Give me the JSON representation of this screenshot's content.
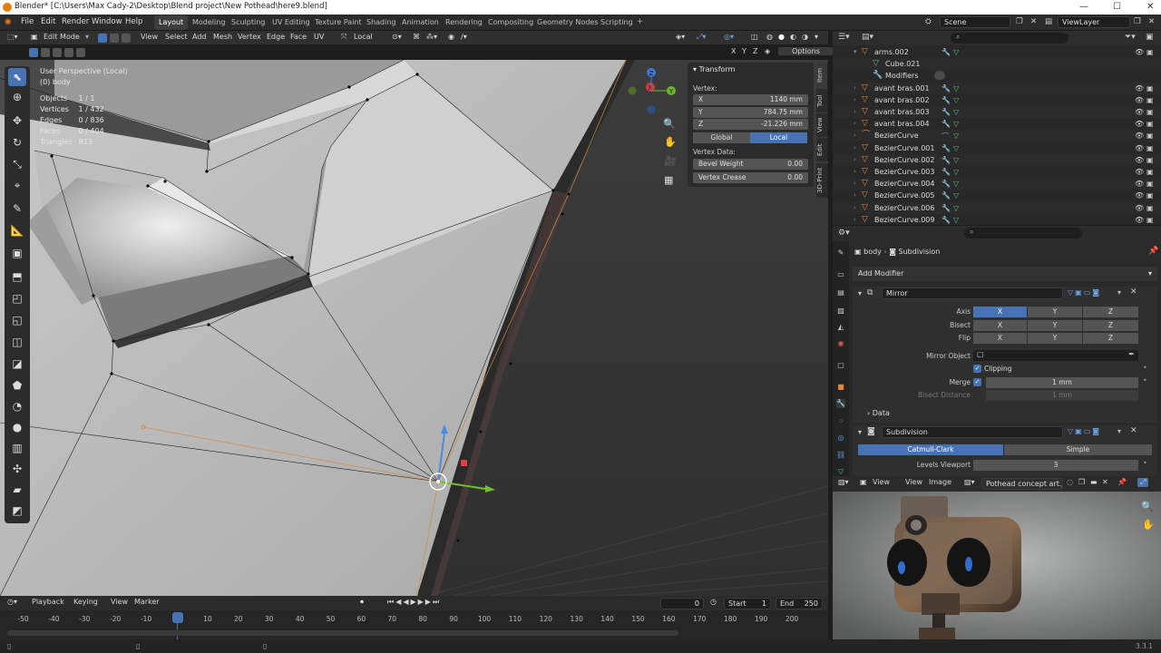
{
  "window": {
    "title": "Blender* [C:\\Users\\Max Cady-2\\Desktop\\Blend project\\New Pothead\\here9.blend]"
  },
  "menu": [
    "File",
    "Edit",
    "Render",
    "Window",
    "Help"
  ],
  "workspaces": [
    "Layout",
    "Modeling",
    "Sculpting",
    "UV Editing",
    "Texture Paint",
    "Shading",
    "Animation",
    "Rendering",
    "Compositing",
    "Geometry Nodes",
    "Scripting"
  ],
  "active_workspace": "Layout",
  "scene": "Scene",
  "view_layer": "ViewLayer",
  "viewport_header": {
    "mode": "Edit Mode",
    "menus": [
      "View",
      "Select",
      "Add",
      "Mesh",
      "Vertex",
      "Edge",
      "Face",
      "UV"
    ],
    "orientation": "Local",
    "axes": [
      "X",
      "Y",
      "Z"
    ],
    "options": "Options"
  },
  "overlay_info": {
    "view": "User Perspective (Local)",
    "object": "(0) body",
    "stats": [
      {
        "k": "Objects",
        "v": "1 / 1"
      },
      {
        "k": "Vertices",
        "v": "1 / 432"
      },
      {
        "k": "Edges",
        "v": "0 / 836"
      },
      {
        "k": "Faces",
        "v": "0 / 404"
      },
      {
        "k": "Triangles",
        "v": "813"
      }
    ]
  },
  "n_panel": {
    "section": "Transform",
    "vertex_label": "Vertex:",
    "x": "1140 mm",
    "y": "784.75 mm",
    "z": "-21.226 mm",
    "global": "Global",
    "local": "Local",
    "vertex_data_label": "Vertex Data:",
    "bevel_weight_label": "Bevel Weight",
    "bevel_weight": "0.00",
    "vertex_crease_label": "Vertex Crease",
    "vertex_crease": "0.00",
    "tabs": [
      "Item",
      "Tool",
      "View",
      "Edit",
      "3D-Print"
    ]
  },
  "outliner": [
    {
      "name": "arms.002",
      "indent": 1,
      "type": "mesh",
      "open": true
    },
    {
      "name": "Cube.021",
      "indent": 2,
      "type": "data"
    },
    {
      "name": "Modifiers",
      "indent": 2,
      "type": "modifiers"
    },
    {
      "name": "avant bras.001",
      "indent": 1,
      "type": "mesh"
    },
    {
      "name": "avant bras.002",
      "indent": 1,
      "type": "mesh"
    },
    {
      "name": "avant bras.003",
      "indent": 1,
      "type": "mesh"
    },
    {
      "name": "avant bras.004",
      "indent": 1,
      "type": "mesh"
    },
    {
      "name": "BezierCurve",
      "indent": 1,
      "type": "curve"
    },
    {
      "name": "BezierCurve.001",
      "indent": 1,
      "type": "mesh"
    },
    {
      "name": "BezierCurve.002",
      "indent": 1,
      "type": "mesh"
    },
    {
      "name": "BezierCurve.003",
      "indent": 1,
      "type": "mesh"
    },
    {
      "name": "BezierCurve.004",
      "indent": 1,
      "type": "mesh"
    },
    {
      "name": "BezierCurve.005",
      "indent": 1,
      "type": "mesh"
    },
    {
      "name": "BezierCurve.006",
      "indent": 1,
      "type": "mesh"
    },
    {
      "name": "BezierCurve.009",
      "indent": 1,
      "type": "mesh"
    }
  ],
  "properties": {
    "breadcrumb_object": "body",
    "breadcrumb_modifier": "Subdivision",
    "add_modifier": "Add Modifier",
    "mirror": {
      "name": "Mirror",
      "axis_label": "Axis",
      "bisect_label": "Bisect",
      "flip_label": "Flip",
      "xyz": [
        "X",
        "Y",
        "Z"
      ],
      "mirror_object_label": "Mirror Object",
      "clipping": "Clipping",
      "merge_label": "Merge",
      "merge_value": "1 mm",
      "bisect_distance_label": "Bisect Distance",
      "bisect_distance": "1 mm",
      "data_label": "Data"
    },
    "subdivision": {
      "name": "Subdivision",
      "catmull": "Catmull-Clark",
      "simple": "Simple",
      "levels_viewport_label": "Levels Viewport",
      "levels_viewport": "3"
    }
  },
  "image_editor": {
    "menus": [
      "View",
      "View",
      "Image"
    ],
    "image_name": "Pothead concept art.jpg"
  },
  "timeline": {
    "menus": [
      "Playback",
      "Keying",
      "View",
      "Marker"
    ],
    "current_frame": "0",
    "start_label": "Start",
    "start": "1",
    "end_label": "End",
    "end": "250",
    "ticks": [
      "-50",
      "-40",
      "-30",
      "-20",
      "-10",
      "0",
      "10",
      "20",
      "30",
      "40",
      "50",
      "60",
      "70",
      "80",
      "90",
      "100",
      "110",
      "120",
      "130",
      "140",
      "150",
      "160",
      "170",
      "180",
      "190",
      "200"
    ]
  },
  "version": "3.3.1",
  "colors": {
    "accent": "#4772b3",
    "orange": "#e2873d"
  }
}
